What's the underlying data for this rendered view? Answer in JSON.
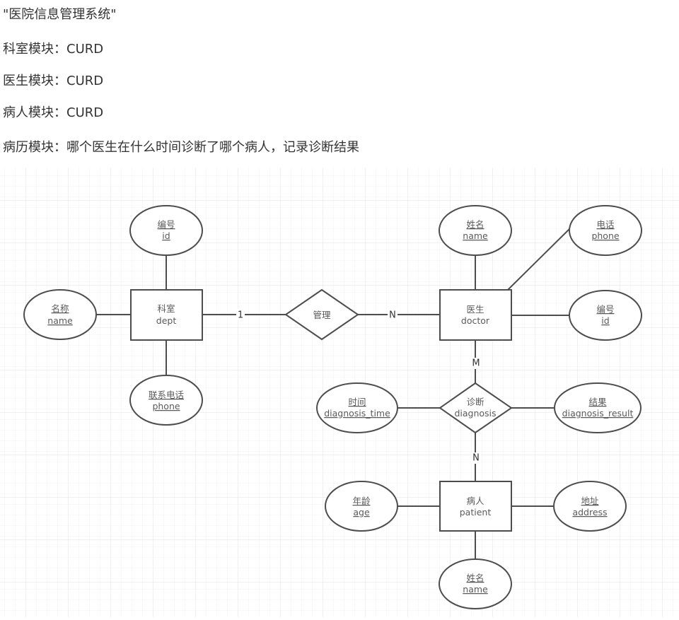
{
  "document": {
    "lines": [
      "\"医院信息管理系统\"",
      "科室模块：CURD",
      "医生模块：CURD",
      "病人模块：CURD",
      "病历模块：哪个医生在什么时间诊断了哪个病人，记录诊断结果"
    ]
  },
  "diagram": {
    "type": "er-diagram",
    "entities": [
      {
        "id": "dept",
        "label_cn": "科室",
        "label_en": "dept"
      },
      {
        "id": "doctor",
        "label_cn": "医生",
        "label_en": "doctor"
      },
      {
        "id": "patient",
        "label_cn": "病人",
        "label_en": "patient"
      }
    ],
    "relationships": [
      {
        "id": "manage",
        "label_cn": "管理",
        "label_en": "",
        "from": "dept",
        "to": "doctor",
        "from_card": "1",
        "to_card": "N"
      },
      {
        "id": "diagnosis",
        "label_cn": "诊断",
        "label_en": "diagnosis",
        "from": "doctor",
        "to": "patient",
        "from_card": "M",
        "to_card": "N"
      }
    ],
    "attributes": [
      {
        "id": "dept_id",
        "owner": "dept",
        "label_cn": "编号",
        "label_en": "id"
      },
      {
        "id": "dept_name",
        "owner": "dept",
        "label_cn": "名称",
        "label_en": "name"
      },
      {
        "id": "dept_phone",
        "owner": "dept",
        "label_cn": "联系电话",
        "label_en": "phone"
      },
      {
        "id": "doctor_name",
        "owner": "doctor",
        "label_cn": "姓名",
        "label_en": "name"
      },
      {
        "id": "doctor_phone",
        "owner": "doctor",
        "label_cn": "电话",
        "label_en": "phone"
      },
      {
        "id": "doctor_id",
        "owner": "doctor",
        "label_cn": "编号",
        "label_en": "id"
      },
      {
        "id": "diag_time",
        "owner": "diagnosis",
        "label_cn": "时间",
        "label_en": "diagnosis_time"
      },
      {
        "id": "diag_result",
        "owner": "diagnosis",
        "label_cn": "结果",
        "label_en": "diagnosis_result"
      },
      {
        "id": "patient_age",
        "owner": "patient",
        "label_cn": "年龄",
        "label_en": "age"
      },
      {
        "id": "patient_address",
        "owner": "patient",
        "label_cn": "地址",
        "label_en": "address"
      },
      {
        "id": "patient_name",
        "owner": "patient",
        "label_cn": "姓名",
        "label_en": "name"
      }
    ],
    "colors": {
      "stroke": "#4d4d4d",
      "text": "#5a5a5a",
      "grid_minor": "#f0f0f0",
      "grid_major": "#e2e2e2"
    }
  }
}
